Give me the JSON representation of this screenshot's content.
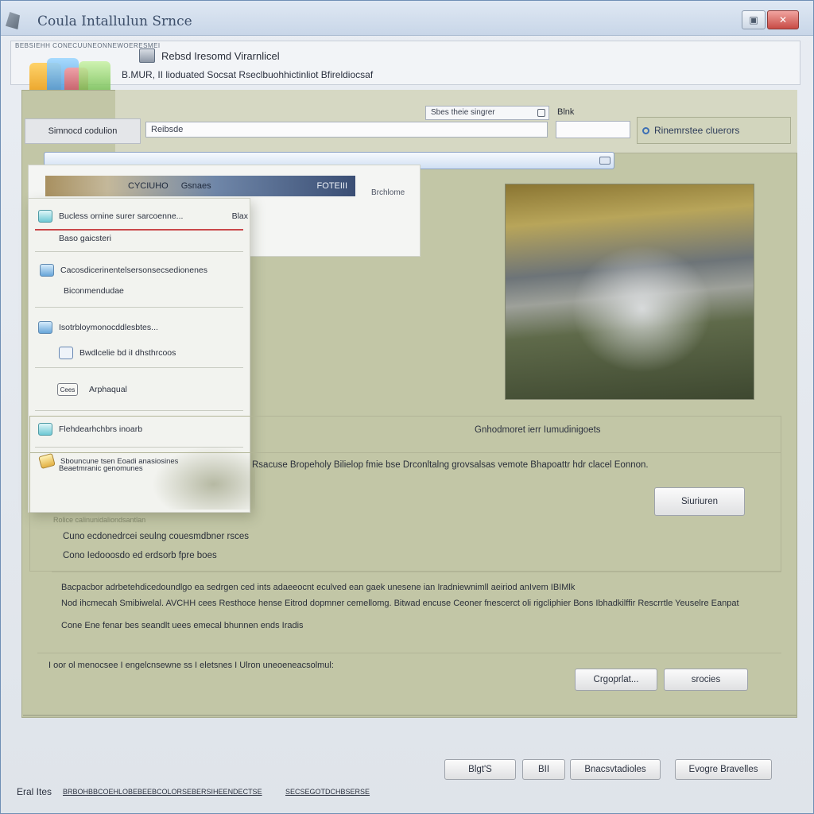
{
  "window": {
    "title": "Coula  Intallulun Srnce",
    "colors": {
      "titlebar": "#c8d6e8",
      "panel": "#c2c6a6",
      "close": "#c84b45"
    }
  },
  "header": {
    "caption": "BEBSIEHH CONECUUNEONNEWOERESMEI",
    "line1": "Rebsd Iresomd Virarnlicel",
    "line2": "B.MUR, II lioduated Socsat Rseclbuohhictinliot Bfireldiocsaf"
  },
  "toolbar": {
    "search_value": "Sbes theie singrer",
    "blnk_label": "Blnk",
    "row_label": "Simnocd codulion",
    "input_value": "Reibsde",
    "link_label": "Rinemrstee cluerors",
    "progress_fraction": 1.0
  },
  "strip": {
    "left_label": "CYCIUHO",
    "mid_label": "Gsnaes",
    "right_label": "FOTEIII",
    "side_label": "Brchlome"
  },
  "menu": {
    "items": [
      {
        "label": "Bucless ornine surer sarcoenne...",
        "right": "Blax",
        "icon": "parrot-icon"
      },
      {
        "label": "Baso gaicsteri",
        "icon": ""
      },
      {
        "label": "Cacosdicerinentelsersonsecsedionenes",
        "icon": "grid-icon"
      },
      {
        "label": "Biconmendudae",
        "icon": ""
      },
      {
        "label": "Isotrbloymonocddlesbtes...",
        "icon": "tile-icon"
      },
      {
        "label": "Bwdlcelie bd iI dhsthrcoos",
        "icon": "window-icon"
      },
      {
        "label": "Arphaqual",
        "icon_text": "Cees",
        "icon": "text-icon"
      },
      {
        "label": "Flehdearhchbrs inoarb",
        "icon": "bottle-icon"
      },
      {
        "label": "Sbouncune tsen Eoadi anasiosines",
        "icon": "pencil-icon"
      },
      {
        "label": "Beaetmranic genomunes",
        "icon": ""
      }
    ]
  },
  "section": {
    "title": "Gnhodmoret ierr Iumudinigoets",
    "desc": "Rsacuse Bropeholy Bilielop fmie bse Drconltalng grovsalsas vemote Bhapoattr hdr clacel Eonnon.",
    "button1": "Siuriuren",
    "fade_text": "Rolice calinunidaliondsantlan",
    "line1": "Cuno ecdonedrcei seulng couesmdbner rsces",
    "line2": "Cono Iedooosdo ed erdsorb fpre boes"
  },
  "details": {
    "line1": "Bacpacbor adrbetehdicedoundlgo ea sedrgen ced ints adaeeocnt eculved ean gaek unesene ian Iradniewnimll aeiriod anIvem IBIMlk",
    "line2": "Nod ihcmecah Smibiwelal. AVCHH cees Resthoce hense Eitrod dopmner cemellomg. Bitwad encuse Ceoner fnescerct oli rigcliphier Bons Ibhadkilffir Rescrrtle Yeuselre Eanpat",
    "line3": "Cone Ene fenar bes seandlt uees emecal bhunnen ends Iradis"
  },
  "confirm": {
    "text": "I oor ol menocsee I engelcnsewne ss I eletsnes I Ulron uneoeneacsolmul:",
    "button_a": "Crgoprlat...",
    "button_b": "srocies"
  },
  "footer": {
    "btn_next": "Blgt'S",
    "btn_mid": "BII",
    "btn_b": "Bnacsvtadioles",
    "btn_c": "Evogre Bravelles"
  },
  "status": {
    "left_label": "Eral Ites",
    "left_value": "BRBOHBBCOEHLOBEBEEBCOLORSEBERSIHEENDECTSE",
    "right_value": "SECSEGOTDCHBSERSE"
  }
}
